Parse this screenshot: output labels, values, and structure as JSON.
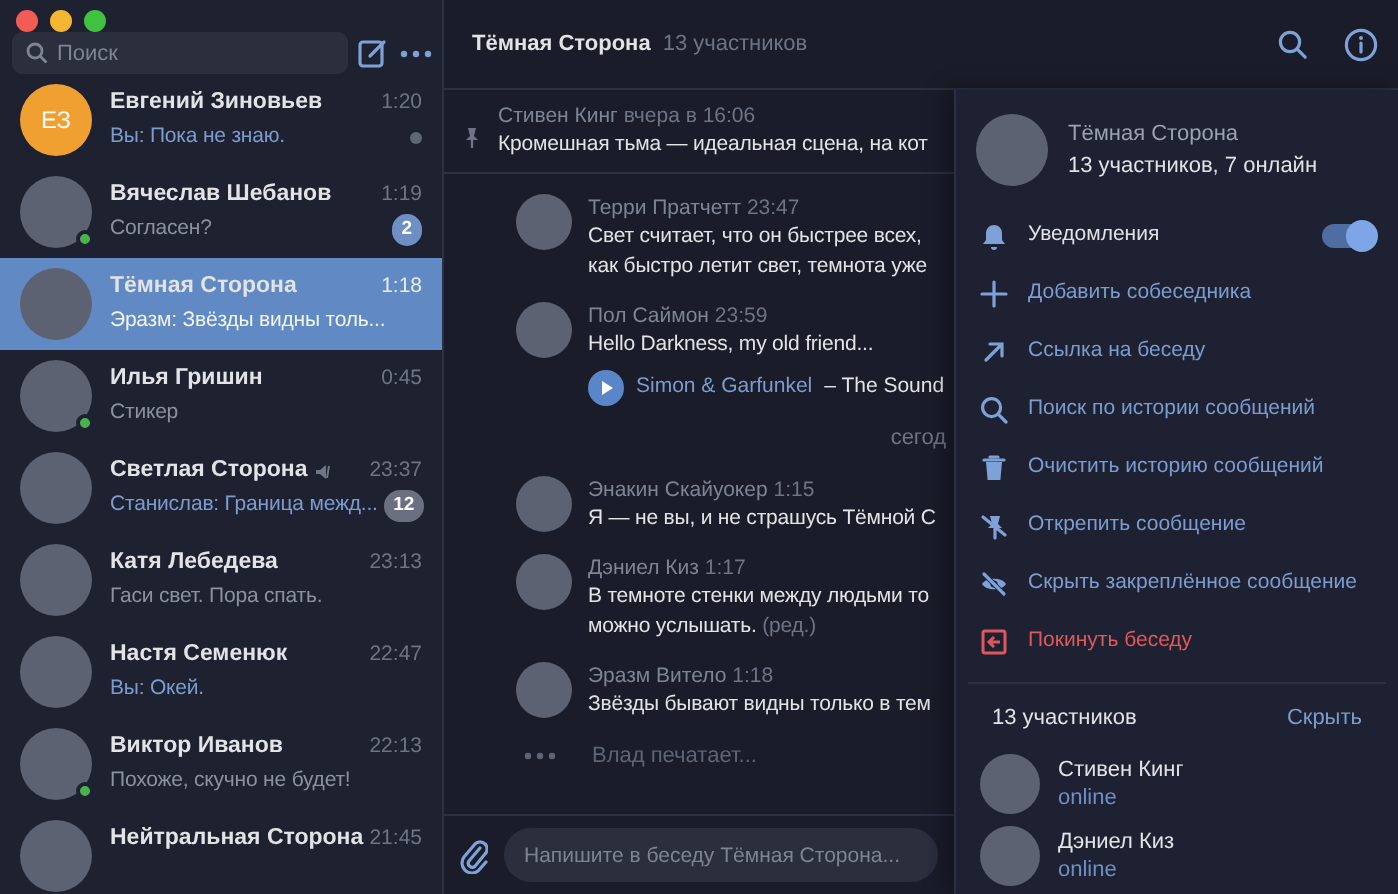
{
  "sidebar": {
    "search": {
      "placeholder": "Поиск"
    },
    "chats": [
      {
        "name": "Евгений Зиновьев",
        "time": "1:20",
        "preview": "Вы: Пока не знаю.",
        "preview_accent": true,
        "avatar": {
          "kind": "initials",
          "text": "ЕЗ"
        },
        "online": false,
        "selected": false,
        "muted": false,
        "unread_dot": true
      },
      {
        "name": "Вячеслав Шебанов",
        "time": "1:19",
        "preview": "Согласен?",
        "preview_accent": false,
        "avatar": {
          "kind": "photo"
        },
        "online": true,
        "selected": false,
        "muted": false,
        "unread_dot": false,
        "badge": "2"
      },
      {
        "name": "Тёмная Сторона",
        "time": "1:18",
        "preview": "Эразм: Звёзды видны толь...",
        "preview_accent": false,
        "avatar": {
          "kind": "photo"
        },
        "online": false,
        "selected": true,
        "muted": false,
        "unread_dot": false
      },
      {
        "name": "Илья Гришин",
        "time": "0:45",
        "preview": "Стикер",
        "preview_accent": false,
        "avatar": {
          "kind": "photo"
        },
        "online": true,
        "selected": false,
        "muted": false,
        "unread_dot": false
      },
      {
        "name": "Светлая Сторона",
        "time": "23:37",
        "preview": "Станислав: Граница межд...",
        "preview_accent": true,
        "avatar": {
          "kind": "photo"
        },
        "online": false,
        "selected": false,
        "muted": true,
        "unread_dot": false,
        "badge": "12"
      },
      {
        "name": "Катя Лебедева",
        "time": "23:13",
        "preview": "Гаси свет. Пора спать.",
        "preview_accent": false,
        "avatar": {
          "kind": "photo"
        },
        "online": false,
        "selected": false,
        "muted": false,
        "unread_dot": false
      },
      {
        "name": "Настя Семенюк",
        "time": "22:47",
        "preview": "Вы: Окей.",
        "preview_accent": true,
        "avatar": {
          "kind": "photo"
        },
        "online": false,
        "selected": false,
        "muted": false,
        "unread_dot": false
      },
      {
        "name": "Виктор Иванов",
        "time": "22:13",
        "preview": "Похоже, скучно не будет!",
        "preview_accent": false,
        "avatar": {
          "kind": "photo"
        },
        "online": true,
        "selected": false,
        "muted": false,
        "unread_dot": false
      },
      {
        "name": "Нейтральная Сторона",
        "time": "21:45",
        "avatar": {
          "kind": "photo"
        },
        "online": false,
        "selected": false,
        "muted": false,
        "unread_dot": false
      }
    ]
  },
  "chat": {
    "title": "Тёмная Сторона",
    "subtitle": "13 участников",
    "pinned": {
      "author": "Стивен Кинг",
      "time": "вчера в 16:06",
      "text": "Кромешная тьма — идеальная сцена, на кот"
    },
    "items": [
      {
        "kind": "message",
        "author": "Терри Пратчетт",
        "time": "23:47",
        "lines": [
          "Свет считает, что он быстрее всех,",
          "как быстро летит свет, темнота уже"
        ]
      },
      {
        "kind": "message",
        "author": "Пол Саймон",
        "time": "23:59",
        "lines": [
          "Hello Darkness, my old friend..."
        ],
        "audio": {
          "artist": "Simon & Garfunkel",
          "title": "– The Sound"
        }
      },
      {
        "kind": "date",
        "text": "сегод"
      },
      {
        "kind": "message",
        "author": "Энакин Скайуокер",
        "time": "1:15",
        "lines": [
          "Я — не вы, и не страшусь Тёмной С"
        ]
      },
      {
        "kind": "message",
        "author": "Дэниел Киз",
        "time": "1:17",
        "lines": [
          "В темноте стенки между людьми то",
          "можно услышать."
        ],
        "edited": "(ред.)"
      },
      {
        "kind": "message",
        "author": "Эразм Витело",
        "time": "1:18",
        "lines": [
          "Звёзды бывают видны только в тем"
        ]
      }
    ],
    "typing": "Влад печатает...",
    "composer": {
      "placeholder": "Напишите в беседу Тёмная Сторона..."
    }
  },
  "info_panel": {
    "title": "Тёмная Сторона",
    "subtitle": "13 участников, 7 онлайн",
    "actions": [
      {
        "kind": "toggle",
        "label": "Уведомления",
        "on": true
      },
      {
        "kind": "action",
        "label": "Добавить собеседника"
      },
      {
        "kind": "action",
        "label": "Ссылка на беседу"
      },
      {
        "kind": "action",
        "label": "Поиск по истории сообщений"
      },
      {
        "kind": "action",
        "label": "Очистить историю сообщений"
      },
      {
        "kind": "action",
        "label": "Открепить сообщение"
      },
      {
        "kind": "action",
        "label": "Скрыть закреплённое сообщение"
      },
      {
        "kind": "danger",
        "label": "Покинуть беседу"
      }
    ],
    "members_title": "13 участников",
    "members_action": "Скрыть",
    "members": [
      {
        "name": "Стивен Кинг",
        "status": "online"
      },
      {
        "name": "Дэниел Киз",
        "status": "online"
      }
    ]
  }
}
